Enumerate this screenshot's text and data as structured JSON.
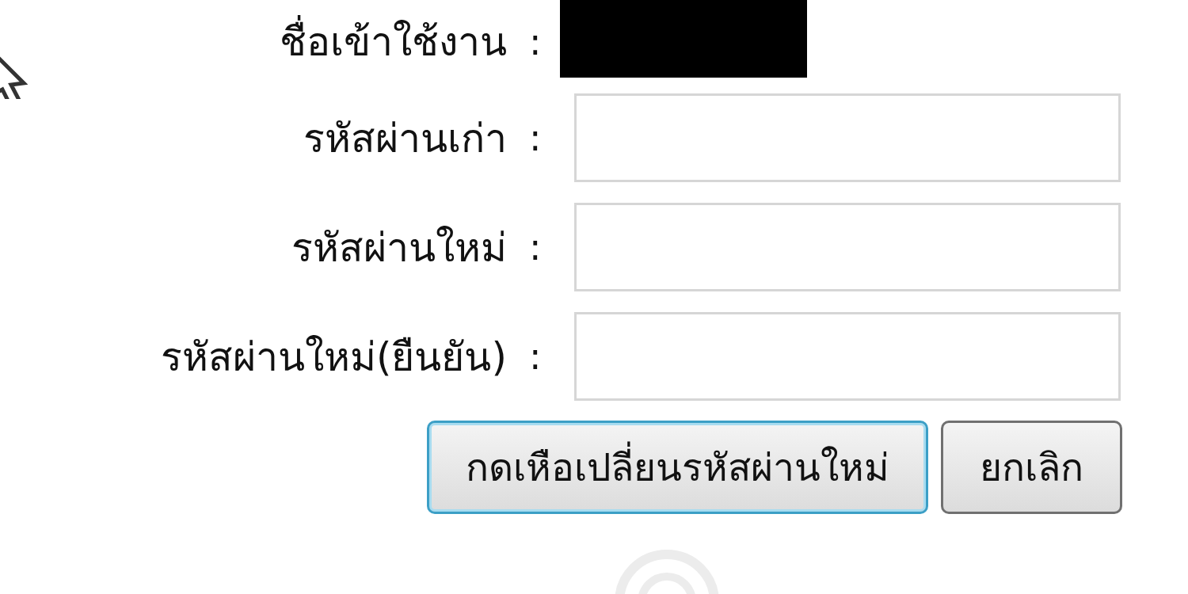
{
  "form": {
    "rows": [
      {
        "kind": "redacted",
        "label": "ชื่อเข้าใช้งาน",
        "separator": ":"
      },
      {
        "kind": "input",
        "label": "รหัสผ่านเก่า",
        "separator": ":"
      },
      {
        "kind": "input",
        "label": "รหัสผ่านใหม่",
        "separator": ":"
      },
      {
        "kind": "input",
        "label": "รหัสผ่านใหม่(ยืนยัน)",
        "separator": ":"
      }
    ],
    "buttons": [
      {
        "label": "กดเหือเปลี่ยนรหัสผ่านใหม่",
        "focused": true
      },
      {
        "label": "ยกเลิก",
        "focused": false
      }
    ]
  }
}
